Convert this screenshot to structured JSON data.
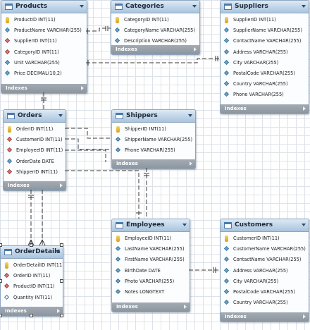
{
  "diagram": {
    "tables": {
      "products": {
        "name": "Products",
        "columns": [
          {
            "label": "ProductID INT(11)",
            "icon": "primary-key-icon"
          },
          {
            "label": "ProductName VARCHAR(255)",
            "icon": "column-icon"
          },
          {
            "label": "SupplierID INT(11)",
            "icon": "foreign-key-icon"
          },
          {
            "label": "CategoryID INT(11)",
            "icon": "foreign-key-icon"
          },
          {
            "label": "Unit VARCHAR(255)",
            "icon": "column-icon"
          },
          {
            "label": "Price DECIMAL(10,2)",
            "icon": "column-icon"
          }
        ],
        "indexes_label": "Indexes"
      },
      "categories": {
        "name": "Categories",
        "columns": [
          {
            "label": "CategoryID INT(11)",
            "icon": "primary-key-icon"
          },
          {
            "label": "CategoryName VARCHAR(255)",
            "icon": "column-icon"
          },
          {
            "label": "Description VARCHAR(255)",
            "icon": "column-icon"
          }
        ],
        "indexes_label": "Indexes"
      },
      "suppliers": {
        "name": "Suppliers",
        "columns": [
          {
            "label": "SupplierID INT(11)",
            "icon": "primary-key-icon"
          },
          {
            "label": "SupplierName VARCHAR(255)",
            "icon": "column-icon"
          },
          {
            "label": "ContactName VARCHAR(255)",
            "icon": "column-icon"
          },
          {
            "label": "Address VARCHAR(255)",
            "icon": "column-icon"
          },
          {
            "label": "City VARCHAR(255)",
            "icon": "column-icon"
          },
          {
            "label": "PostalCode VARCHAR(255)",
            "icon": "column-icon"
          },
          {
            "label": "Country VARCHAR(255)",
            "icon": "column-icon"
          },
          {
            "label": "Phone VARCHAR(255)",
            "icon": "column-icon"
          }
        ],
        "indexes_label": "Indexes"
      },
      "orders": {
        "name": "Orders",
        "columns": [
          {
            "label": "OrderID INT(11)",
            "icon": "primary-key-icon"
          },
          {
            "label": "CustomerID INT(11)",
            "icon": "foreign-key-icon"
          },
          {
            "label": "EmployeeID INT(11)",
            "icon": "foreign-key-icon"
          },
          {
            "label": "OrderDate DATE",
            "icon": "column-icon"
          },
          {
            "label": "ShipperID INT(11)",
            "icon": "foreign-key-icon"
          }
        ],
        "indexes_label": "Indexes"
      },
      "shippers": {
        "name": "Shippers",
        "columns": [
          {
            "label": "ShipperID INT(11)",
            "icon": "primary-key-icon"
          },
          {
            "label": "ShipperName VARCHAR(255)",
            "icon": "column-icon"
          },
          {
            "label": "Phone VARCHAR(255)",
            "icon": "column-icon"
          }
        ],
        "indexes_label": "Indexes"
      },
      "employees": {
        "name": "Employees",
        "columns": [
          {
            "label": "EmployeeID INT(11)",
            "icon": "primary-key-icon"
          },
          {
            "label": "LastName VARCHAR(255)",
            "icon": "column-icon"
          },
          {
            "label": "FirstName VARCHAR(255)",
            "icon": "column-icon"
          },
          {
            "label": "BirthDate DATE",
            "icon": "column-icon"
          },
          {
            "label": "Photo VARCHAR(255)",
            "icon": "column-icon"
          },
          {
            "label": "Notes LONGTEXT",
            "icon": "column-icon"
          }
        ],
        "indexes_label": "Indexes"
      },
      "customers": {
        "name": "Customers",
        "columns": [
          {
            "label": "CustomerID INT(11)",
            "icon": "primary-key-icon"
          },
          {
            "label": "CustomerName VARCHAR(255)",
            "icon": "column-icon"
          },
          {
            "label": "ContactName VARCHAR(255)",
            "icon": "column-icon"
          },
          {
            "label": "Address VARCHAR(255)",
            "icon": "column-icon"
          },
          {
            "label": "City VARCHAR(255)",
            "icon": "column-icon"
          },
          {
            "label": "PostalCode VARCHAR(255)",
            "icon": "column-icon"
          },
          {
            "label": "Country VARCHAR(255)",
            "icon": "column-icon"
          }
        ],
        "indexes_label": "Indexes"
      },
      "orderdetails": {
        "name": "OrderDetails",
        "columns": [
          {
            "label": "OrderDetailID INT(11)",
            "icon": "primary-key-icon"
          },
          {
            "label": "OrderID INT(11)",
            "icon": "foreign-key-icon"
          },
          {
            "label": "ProductID INT(11)",
            "icon": "foreign-key-icon"
          },
          {
            "label": "Quantity INT(11)",
            "icon": "nullable-column-icon"
          }
        ],
        "indexes_label": "Indexes"
      }
    }
  }
}
